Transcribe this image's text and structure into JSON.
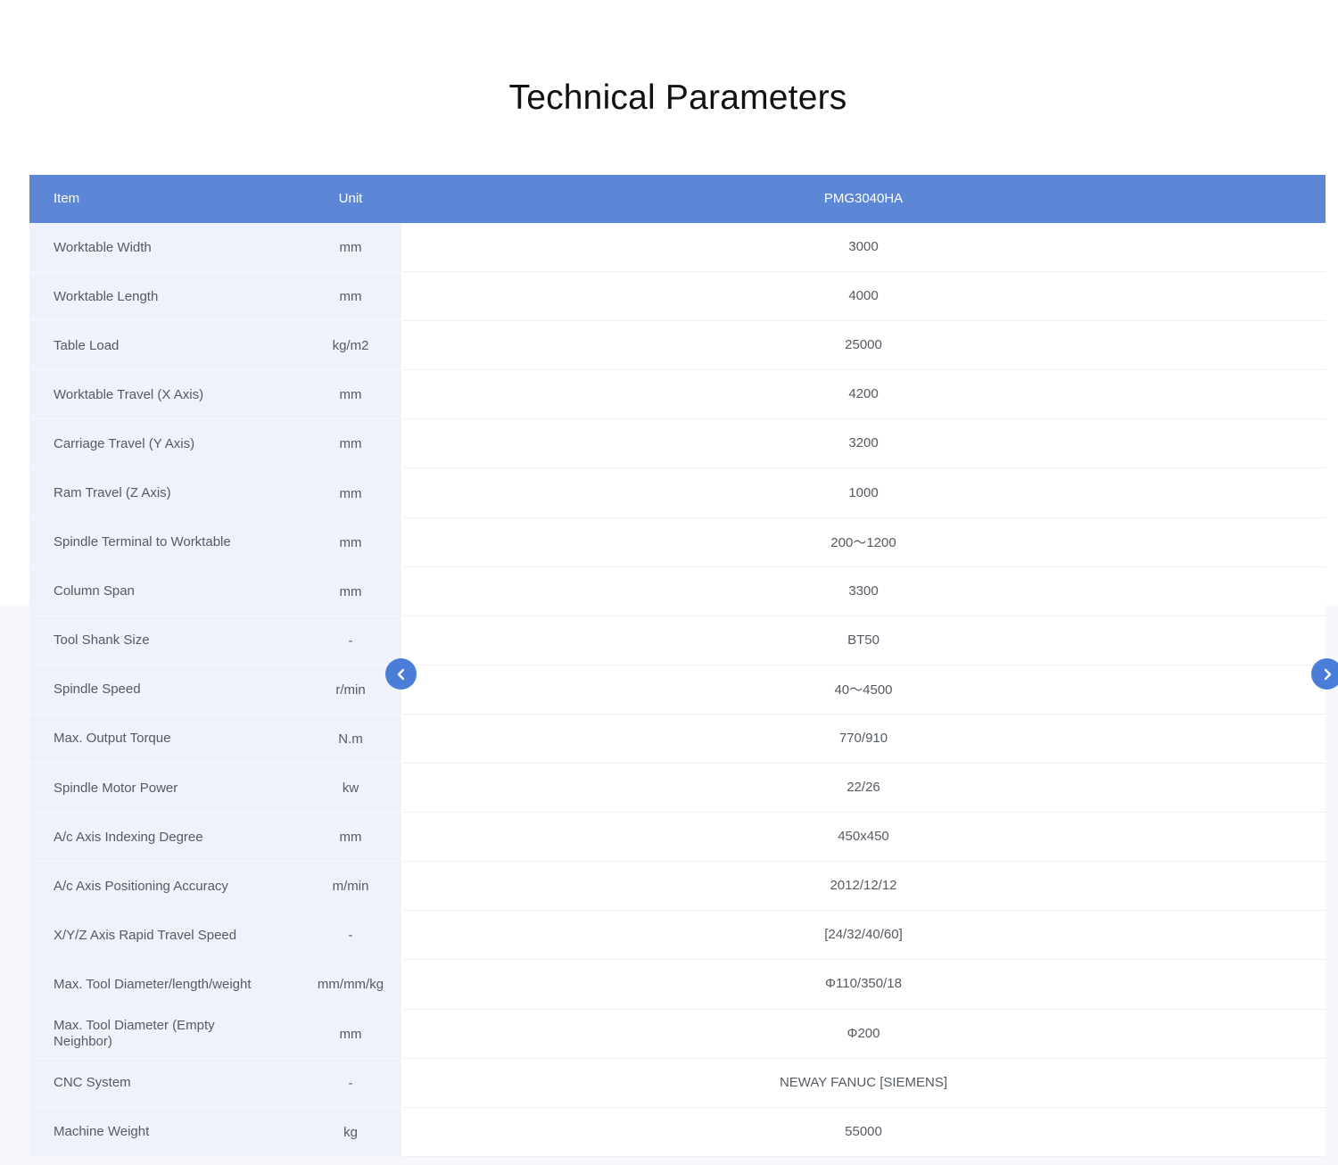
{
  "page": {
    "title": "Technical Parameters"
  },
  "table": {
    "headers": {
      "item": "Item",
      "unit": "Unit",
      "value": "PMG3040HA"
    },
    "rows": [
      {
        "item": "Worktable Width",
        "unit": "mm",
        "value": "3000"
      },
      {
        "item": "Worktable Length",
        "unit": "mm",
        "value": "4000"
      },
      {
        "item": "Table Load",
        "unit": "kg/m2",
        "value": "25000"
      },
      {
        "item": "Worktable Travel (X Axis)",
        "unit": "mm",
        "value": "4200"
      },
      {
        "item": "Carriage Travel (Y Axis)",
        "unit": "mm",
        "value": "3200"
      },
      {
        "item": "Ram Travel (Z Axis)",
        "unit": "mm",
        "value": "1000"
      },
      {
        "item": "Spindle Terminal to Worktable",
        "unit": "mm",
        "value": "200～1200"
      },
      {
        "item": "Column Span",
        "unit": "mm",
        "value": "3300"
      },
      {
        "item": "Tool Shank Size",
        "unit": "-",
        "value": "BT50"
      },
      {
        "item": "Spindle Speed",
        "unit": "r/min",
        "value": "40～4500"
      },
      {
        "item": "Max. Output Torque",
        "unit": "N.m",
        "value": "770/910"
      },
      {
        "item": "Spindle Motor Power",
        "unit": "kw",
        "value": "22/26"
      },
      {
        "item": "A/c Axis Indexing Degree",
        "unit": "mm",
        "value": "450x450"
      },
      {
        "item": "A/c Axis Positioning Accuracy",
        "unit": "m/min",
        "value": "2012/12/12"
      },
      {
        "item": "X/Y/Z Axis Rapid Travel Speed",
        "unit": "-",
        "value": "[24/32/40/60]"
      },
      {
        "item": "Max. Tool Diameter/length/weight",
        "unit": "mm/mm/kg",
        "value": "Φ110/350/18"
      },
      {
        "item": "Max. Tool Diameter (Empty Neighbor)",
        "unit": "mm",
        "value": "Φ200"
      },
      {
        "item": "CNC System",
        "unit": "-",
        "value": "NEWAY FANUC [SIEMENS]"
      },
      {
        "item": "Machine Weight",
        "unit": "kg",
        "value": "55000"
      }
    ]
  },
  "navigation": {
    "prev_icon": "chevron-left-icon",
    "next_icon": "chevron-right-icon",
    "accent_color": "#4a7dd8"
  },
  "colors": {
    "header_bg": "#5b87d6",
    "left_col_bg": "#eef2fa"
  }
}
